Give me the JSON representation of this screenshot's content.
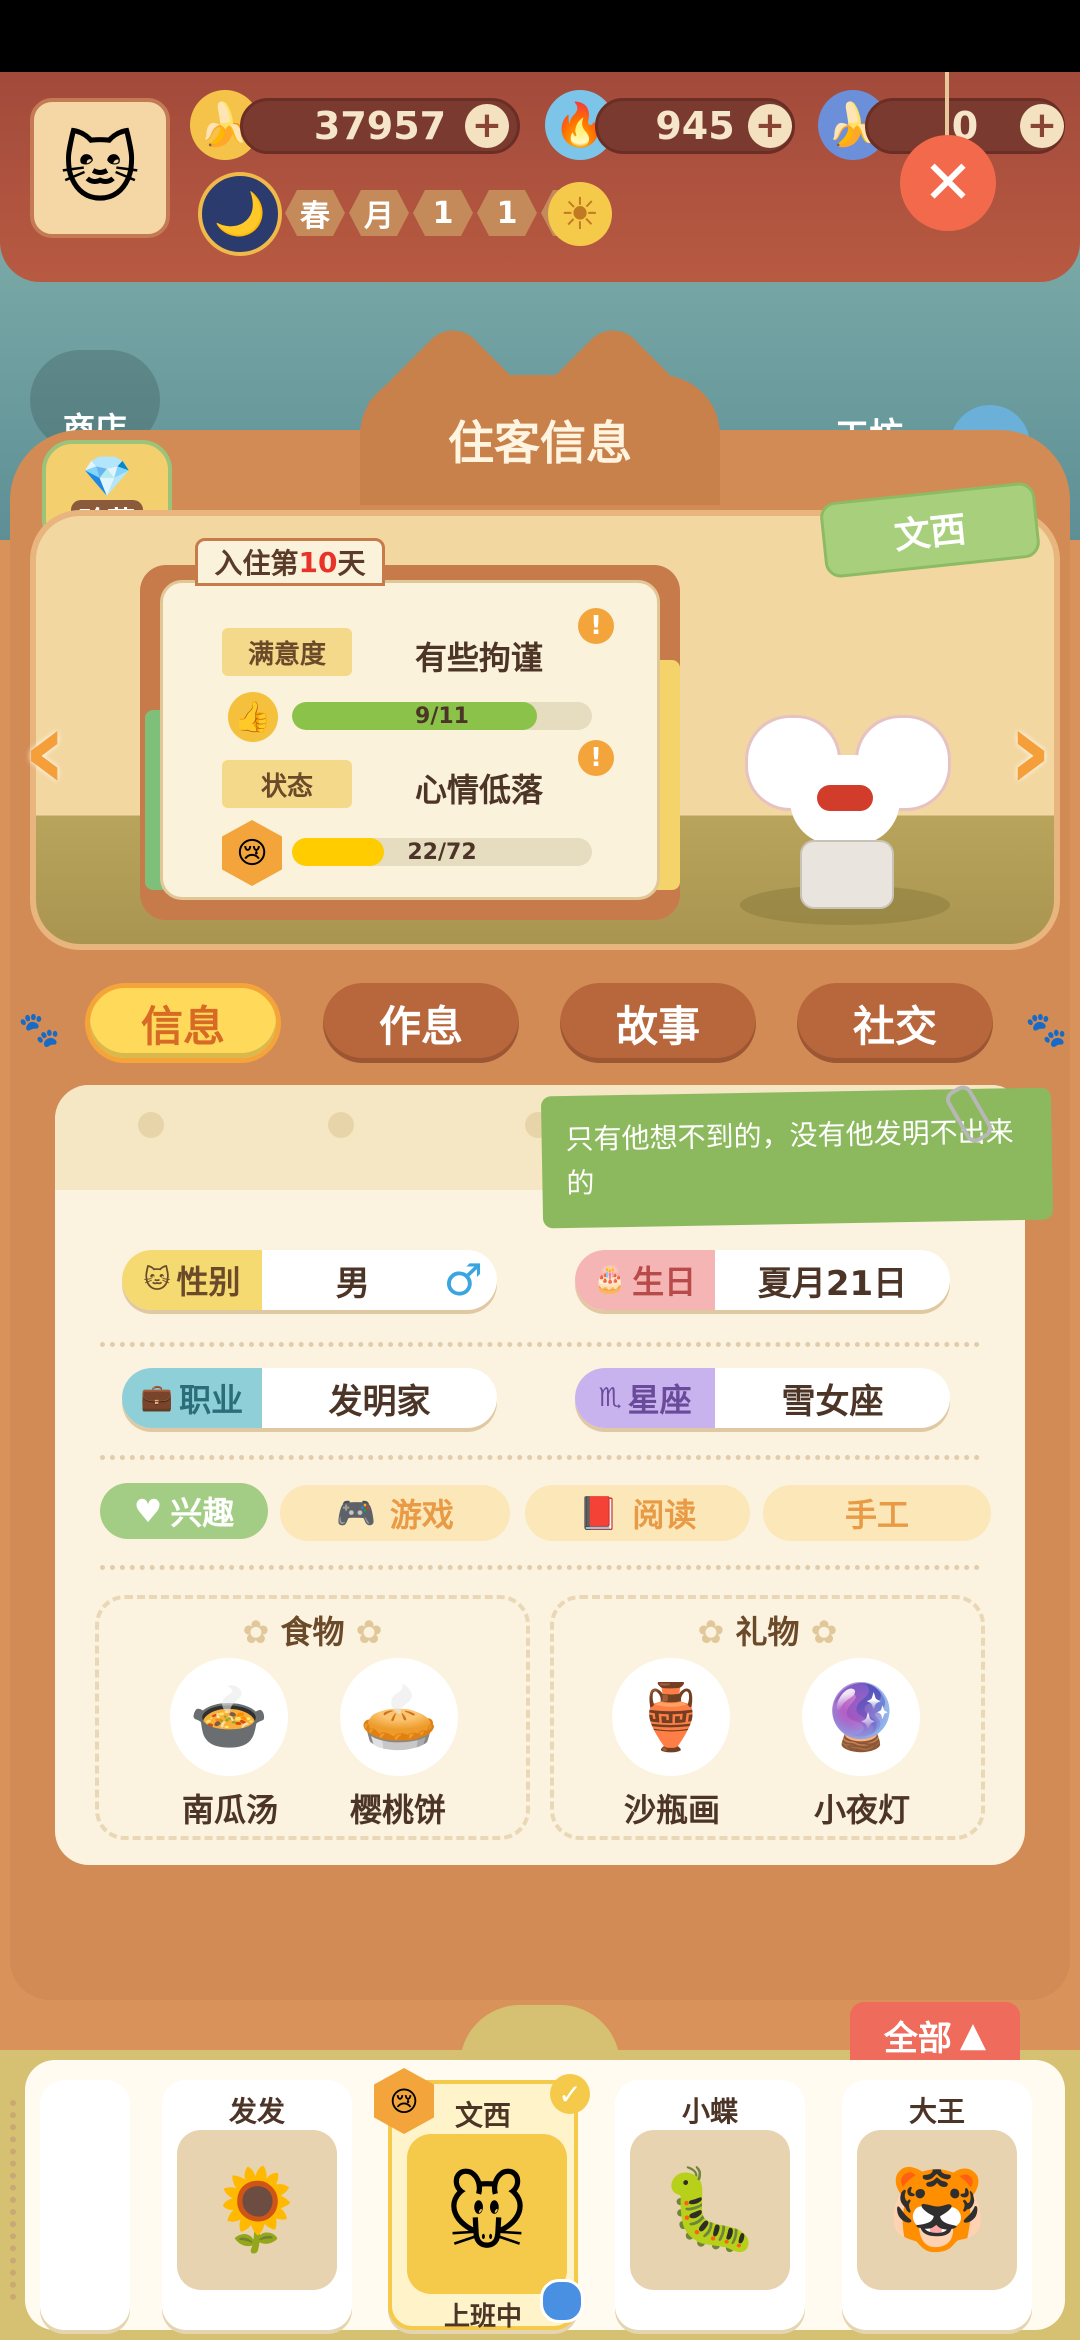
{
  "resources": [
    {
      "icon": "banana-icon",
      "value": "37957"
    },
    {
      "icon": "blue-flame-icon",
      "value": "945"
    },
    {
      "icon": "blue-banana-icon",
      "value": "0"
    }
  ],
  "date": {
    "season": "春",
    "month_label": "月",
    "month": "1",
    "day": "1",
    "day_label": "日"
  },
  "scene": {
    "left_label": "商店",
    "right_label": "工坊",
    "collection_label": "珍藏"
  },
  "panel_title": "住客信息",
  "resident_name": "文西",
  "checkin": {
    "prefix": "入住第",
    "days": "10",
    "suffix": "天"
  },
  "satisfaction": {
    "label": "满意度",
    "value": "有些拘谨",
    "progress_text": "9/11",
    "progress": 0.818
  },
  "mood": {
    "label": "状态",
    "value": "心情低落",
    "progress_text": "22/72",
    "progress": 0.305
  },
  "tabs": [
    "信息",
    "作息",
    "故事",
    "社交"
  ],
  "quote": "只有他想不到的，没有他发明不出来的",
  "attributes": {
    "gender": {
      "label": "性别",
      "value": "男"
    },
    "birthday": {
      "label": "生日",
      "value": "夏月21日"
    },
    "job": {
      "label": "职业",
      "value": "发明家"
    },
    "zodiac": {
      "label": "星座",
      "value": "雪女座"
    }
  },
  "hobbies": {
    "label": "兴趣",
    "items": [
      "游戏",
      "阅读",
      "手工"
    ]
  },
  "food": {
    "title": "食物",
    "items": [
      "南瓜汤",
      "樱桃饼"
    ]
  },
  "gifts": {
    "title": "礼物",
    "items": [
      "沙瓶画",
      "小夜灯"
    ]
  },
  "all_button": "全部",
  "residents": [
    {
      "name": "发发",
      "status": ""
    },
    {
      "name": "文西",
      "status": "上班中"
    },
    {
      "name": "小蝶",
      "status": ""
    },
    {
      "name": "大王",
      "status": ""
    }
  ],
  "colors": {
    "accent": "#ffd95a",
    "tab": "#b8663c",
    "progress_green": "#8bc34a",
    "progress_yellow": "#ffcc00"
  }
}
